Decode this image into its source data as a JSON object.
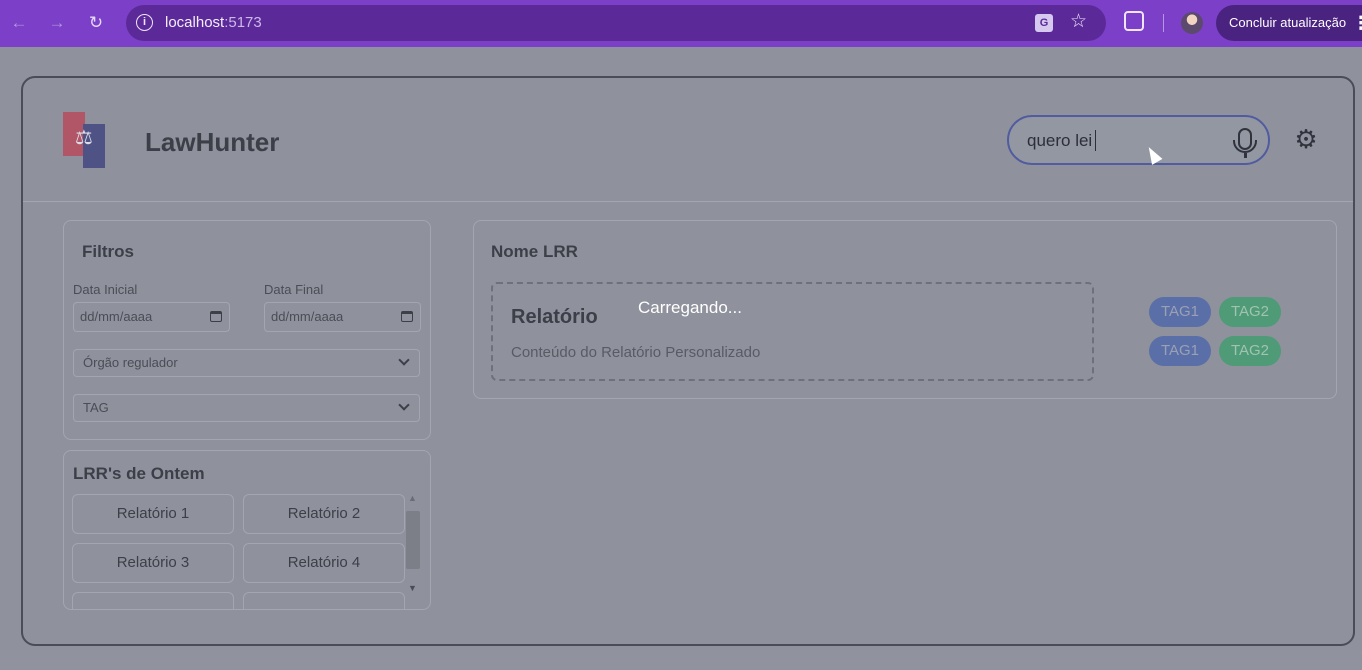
{
  "browser": {
    "url_host": "localhost",
    "url_port": ":5173",
    "update_button": "Concluir atualização"
  },
  "app": {
    "brand": "LawHunter",
    "search": {
      "value": "quero lei"
    },
    "filters": {
      "title": "Filtros",
      "start_label": "Data Inicial",
      "end_label": "Data Final",
      "start_placeholder": "dd/mm/aaaa",
      "end_placeholder": "dd/mm/aaaa",
      "regulator_select": "Órgão regulador",
      "tag_select": "TAG"
    },
    "lrr": {
      "title": "LRR's de Ontem",
      "items": [
        "Relatório 1",
        "Relatório 2",
        "Relatório 3",
        "Relatório 4"
      ]
    },
    "main": {
      "title": "Nome LRR",
      "report_title": "Relatório",
      "report_content": "Conteúdo do Relatório Personalizado",
      "loading": "Carregando...",
      "tags": [
        "TAG1",
        "TAG2",
        "TAG1",
        "TAG2"
      ]
    }
  }
}
